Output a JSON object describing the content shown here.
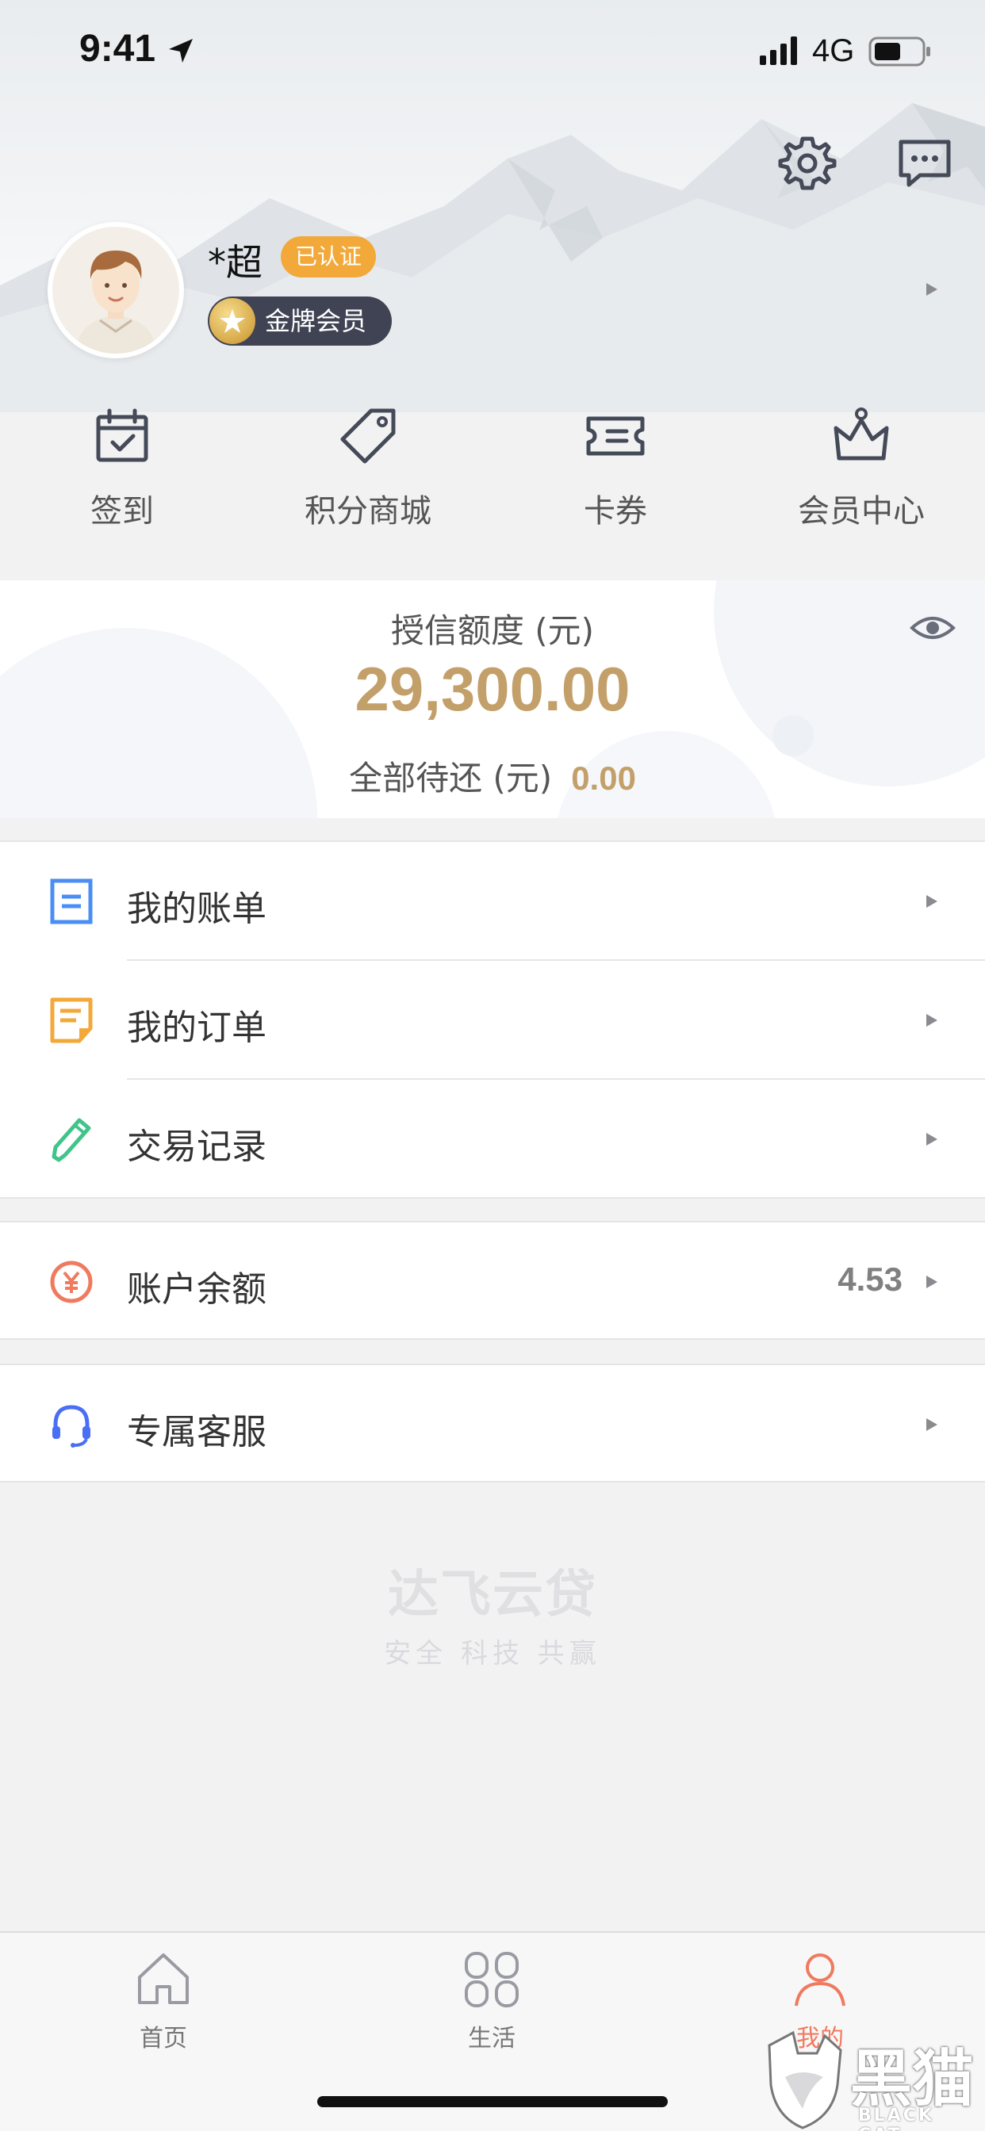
{
  "status_bar": {
    "time": "9:41",
    "network": "4G"
  },
  "profile": {
    "name": "*超",
    "verified_label": "已认证",
    "member_label": "金牌会员"
  },
  "quick_actions": [
    {
      "label": "签到",
      "icon": "calendar-check-icon"
    },
    {
      "label": "积分商城",
      "icon": "tag-icon"
    },
    {
      "label": "卡券",
      "icon": "ticket-icon"
    },
    {
      "label": "会员中心",
      "icon": "crown-icon"
    }
  ],
  "credit": {
    "limit_label": "授信额度 (元)",
    "limit_amount": "29,300.00",
    "pending_label": "全部待还 (元)",
    "pending_amount": "0.00"
  },
  "menu": {
    "bills": "我的账单",
    "orders": "我的订单",
    "transactions": "交易记录",
    "balance_label": "账户余额",
    "balance_value": "4.53",
    "support": "专属客服"
  },
  "brand": {
    "name": "达飞云贷",
    "slogan": "安全 科技 共赢"
  },
  "tabbar": {
    "home": "首页",
    "life": "生活",
    "mine": "我的"
  },
  "corner_watermark": {
    "cn": "黑猫",
    "en": "BLACK CAT"
  },
  "colors": {
    "gold": "#c3a06a",
    "accent_orange": "#f2a93a",
    "active_tab": "#f07a5e",
    "icon_blue": "#4a8df5",
    "icon_green": "#41c48a",
    "icon_balance": "#f07a5e",
    "icon_support": "#4a6ff5"
  }
}
